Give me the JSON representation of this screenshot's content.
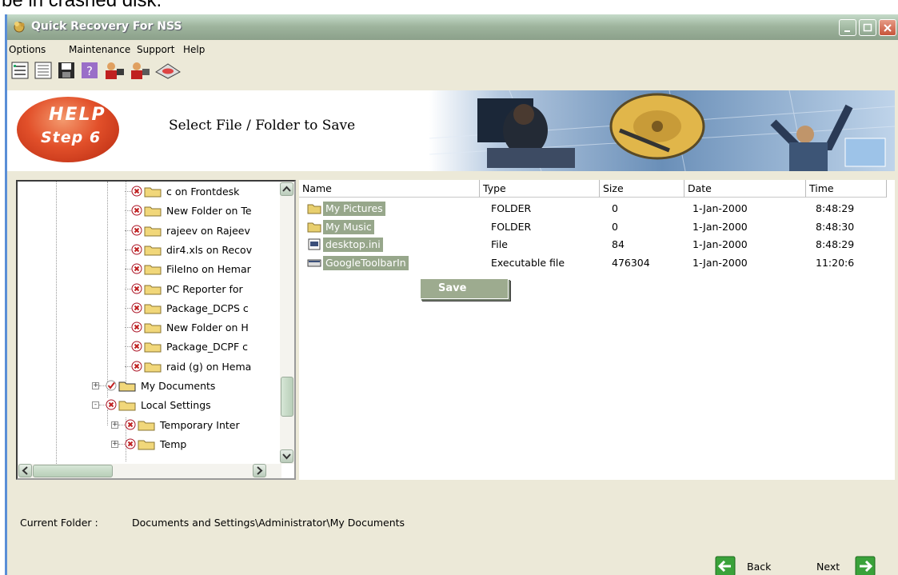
{
  "caption": "be in crashed disk.",
  "window": {
    "title": "Quick Recovery For NSS"
  },
  "menu": [
    "Options",
    "Maintenance",
    "Support",
    "Help"
  ],
  "toolbar": [
    "list-view-icon",
    "details-view-icon",
    "save-icon",
    "help-icon",
    "support-person-icon",
    "user-person-icon",
    "disk-icon"
  ],
  "banner": {
    "help_line1": "HELP",
    "help_line2": "Step 6",
    "instruction": "Select File / Folder to Save"
  },
  "tree": {
    "items": [
      {
        "label": "c on Frontdesk",
        "status": "x",
        "indent": 2
      },
      {
        "label": "New Folder on Te",
        "status": "x",
        "indent": 2
      },
      {
        "label": "rajeev on Rajeev",
        "status": "x",
        "indent": 2
      },
      {
        "label": "dir4.xls on Recov",
        "status": "x",
        "indent": 2
      },
      {
        "label": "FileIno on Hemar",
        "status": "x",
        "indent": 2
      },
      {
        "label": "PC Reporter for",
        "status": "x",
        "indent": 2
      },
      {
        "label": "Package_DCPS c",
        "status": "x",
        "indent": 2
      },
      {
        "label": "New Folder on H",
        "status": "x",
        "indent": 2
      },
      {
        "label": "Package_DCPF c",
        "status": "x",
        "indent": 2
      },
      {
        "label": "raid (g) on Hema",
        "status": "x",
        "indent": 2
      },
      {
        "label": "My Documents",
        "status": "check",
        "indent": 0,
        "expander": "+"
      },
      {
        "label": "Local Settings",
        "status": "x",
        "indent": 0,
        "expander": "-"
      },
      {
        "label": "Temporary Inter",
        "status": "x",
        "indent": 1,
        "expander": "+"
      },
      {
        "label": "Temp",
        "status": "x",
        "indent": 1,
        "expander": "+"
      }
    ]
  },
  "list": {
    "columns": [
      "Name",
      "Type",
      "Size",
      "Date",
      "Time"
    ],
    "rows": [
      {
        "name": "My Pictures",
        "type": "FOLDER",
        "size": "0",
        "date": "1-Jan-2000",
        "time": "8:48:29",
        "icon": "folder-icon"
      },
      {
        "name": "My Music",
        "type": "FOLDER",
        "size": "0",
        "date": "1-Jan-2000",
        "time": "8:48:30",
        "icon": "folder-icon"
      },
      {
        "name": "desktop.ini",
        "type": "File",
        "size": "84",
        "date": "1-Jan-2000",
        "time": "8:48:29",
        "icon": "file-icon"
      },
      {
        "name": "GoogleToolbarIn",
        "type": "Executable file",
        "size": "476304",
        "date": "1-Jan-2000",
        "time": "11:20:6",
        "icon": "exe-icon"
      }
    ]
  },
  "context_menu": {
    "items": [
      "Save"
    ]
  },
  "footer": {
    "current_folder_label": "Current Folder :",
    "current_folder_value": "Documents and Settings\\Administrator\\My Documents",
    "back_label": "Back",
    "next_label": "Next"
  },
  "colors": {
    "selection": "#97a78b",
    "title_bar": "#9fb59e",
    "nav_arrow": "#3aa23a",
    "help_oval": "#e2502a"
  }
}
